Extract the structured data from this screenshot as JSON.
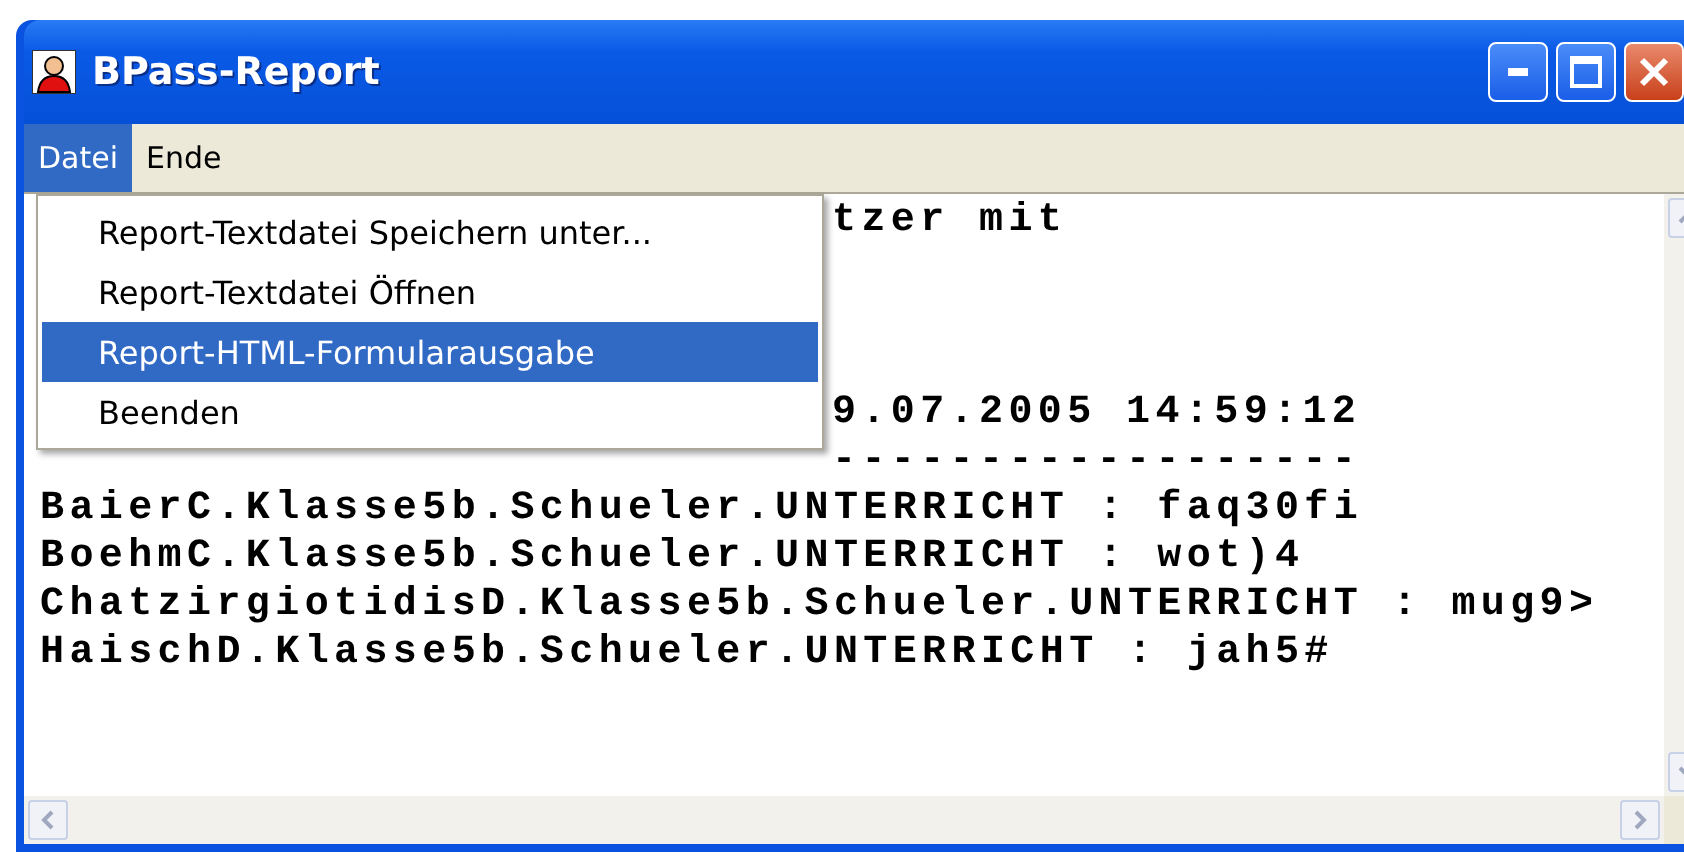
{
  "window": {
    "title": "BPass-Report"
  },
  "menu_bar": [
    {
      "label": "Datei",
      "selected": true
    },
    {
      "label": "Ende",
      "selected": false
    }
  ],
  "open_menu": {
    "items": [
      {
        "label": "Report-Textdatei Speichern unter...",
        "selected": false
      },
      {
        "label": "Report-Textdatei Öffnen",
        "selected": false
      },
      {
        "label": "Report-HTML-Formularausgabe",
        "selected": true
      },
      {
        "label": "Beenden",
        "selected": false
      }
    ]
  },
  "text_area": {
    "partly_covered_lines": [
      "tzer mit",
      "9.07.2005 14:59:12",
      "------------------"
    ],
    "lines": [
      "BaierC.Klasse5b.Schueler.UNTERRICHT : faq30fi",
      "BoehmC.Klasse5b.Schueler.UNTERRICHT : wot)4",
      "ChatzirgiotidisD.Klasse5b.Schueler.UNTERRICHT : mug9>",
      "HaischD.Klasse5b.Schueler.UNTERRICHT : jah5#"
    ]
  }
}
